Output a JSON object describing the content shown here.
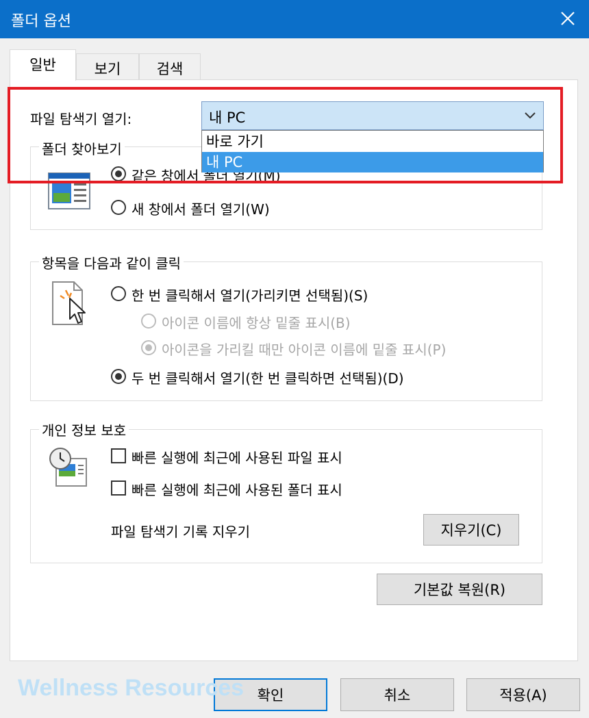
{
  "window": {
    "title": "폴더 옵션"
  },
  "tabs": [
    {
      "label": "일반",
      "active": true
    },
    {
      "label": "보기",
      "active": false
    },
    {
      "label": "검색",
      "active": false
    }
  ],
  "general": {
    "open_explorer_label": "파일 탐색기 열기:",
    "open_explorer_value": "내 PC",
    "dropdown_options": [
      {
        "label": "바로 가기",
        "selected": false
      },
      {
        "label": "내 PC",
        "selected": true
      }
    ]
  },
  "browse_folders": {
    "title": "폴더 찾아보기",
    "options": [
      {
        "label": "같은 창에서 폴더 열기(M)",
        "checked": true
      },
      {
        "label": "새 창에서 폴더 열기(W)",
        "checked": false
      }
    ]
  },
  "click_items": {
    "title": "항목을 다음과 같이 클릭",
    "single_click": {
      "label": "한 번 클릭해서 열기(가리키면 선택됨)(S)",
      "checked": false
    },
    "underline_always": {
      "label": "아이콘 이름에 항상 밑줄 표시(B)",
      "checked": false,
      "disabled": true
    },
    "underline_hover": {
      "label": "아이콘을 가리킬 때만 아이콘 이름에 밑줄 표시(P)",
      "checked": true,
      "disabled": true
    },
    "double_click": {
      "label": "두 번 클릭해서 열기(한 번 클릭하면 선택됨)(D)",
      "checked": true
    }
  },
  "privacy": {
    "title": "개인 정보 보호",
    "show_recent_files": {
      "label": "빠른 실행에 최근에 사용된 파일 표시",
      "checked": false
    },
    "show_recent_folders": {
      "label": "빠른 실행에 최근에 사용된 폴더 표시",
      "checked": false
    },
    "clear_history_label": "파일 탐색기 기록 지우기",
    "clear_button": "지우기(C)"
  },
  "restore_defaults_button": "기본값 복원(R)",
  "footer": {
    "ok": "확인",
    "cancel": "취소",
    "apply": "적용(A)"
  },
  "watermark": "Wellness Resources",
  "colors": {
    "titlebar": "#0b6fc9",
    "highlight_box": "#e41c24",
    "dropdown_selected": "#3c9be8",
    "combo_background": "#cce4f7"
  }
}
